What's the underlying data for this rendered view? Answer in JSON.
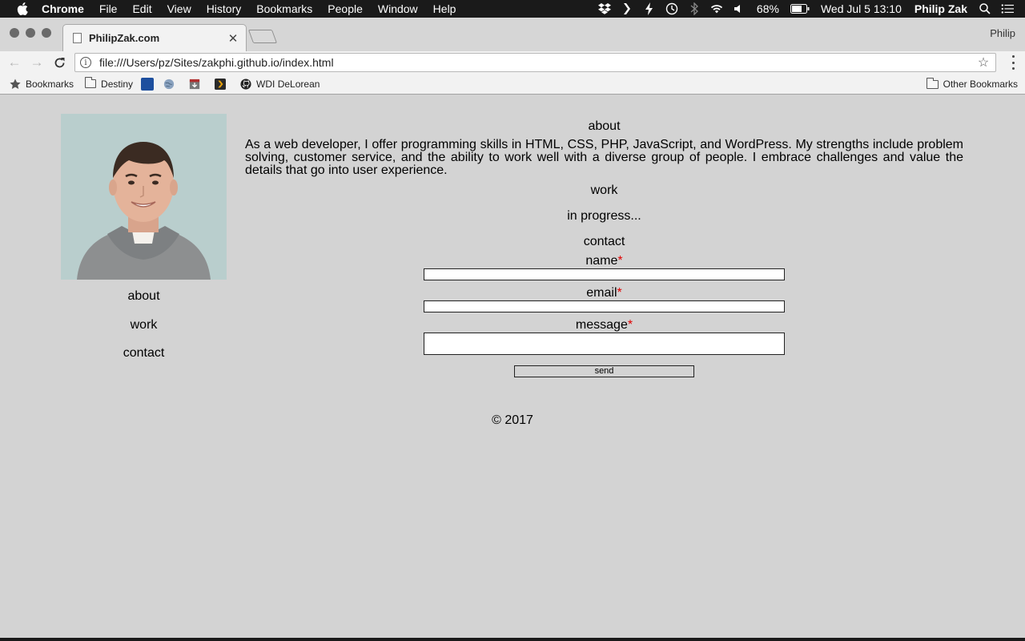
{
  "menubar": {
    "app_name": "Chrome",
    "items": [
      "File",
      "Edit",
      "View",
      "History",
      "Bookmarks",
      "People",
      "Window",
      "Help"
    ],
    "battery": "68%",
    "clock": "Wed Jul 5  13:10",
    "user": "Philip Zak",
    "icons": [
      "dropbox-icon",
      "arrow-icon",
      "bolt-icon",
      "time-machine-icon",
      "bluetooth-icon",
      "wifi-icon",
      "volume-icon",
      "battery-icon",
      "spotlight-icon",
      "notification-center-icon"
    ]
  },
  "browser": {
    "tab_title": "PhilipZak.com",
    "profile_name": "Philip",
    "url": "file:///Users/pz/Sites/zakphi.github.io/index.html",
    "bookmarks": {
      "bookmarks_label": "Bookmarks",
      "destiny_label": "Destiny",
      "wdi_label": "WDI DeLorean",
      "other_label": "Other Bookmarks"
    }
  },
  "sidebar": {
    "nav": [
      "about",
      "work",
      "contact"
    ]
  },
  "main": {
    "about_title": "about",
    "about_text": "As a web developer, I offer programming skills in HTML, CSS, PHP, JavaScript, and WordPress. My strengths include problem solving, customer service, and the ability to work well with a diverse group of people. I embrace challenges and value the details that go into user experience.",
    "work_title": "work",
    "work_text": "in progress...",
    "contact_title": "contact",
    "form": {
      "name_label": "name",
      "email_label": "email",
      "message_label": "message",
      "required_mark": "*",
      "send_label": "send"
    }
  },
  "footer": {
    "copyright": "© 2017"
  }
}
